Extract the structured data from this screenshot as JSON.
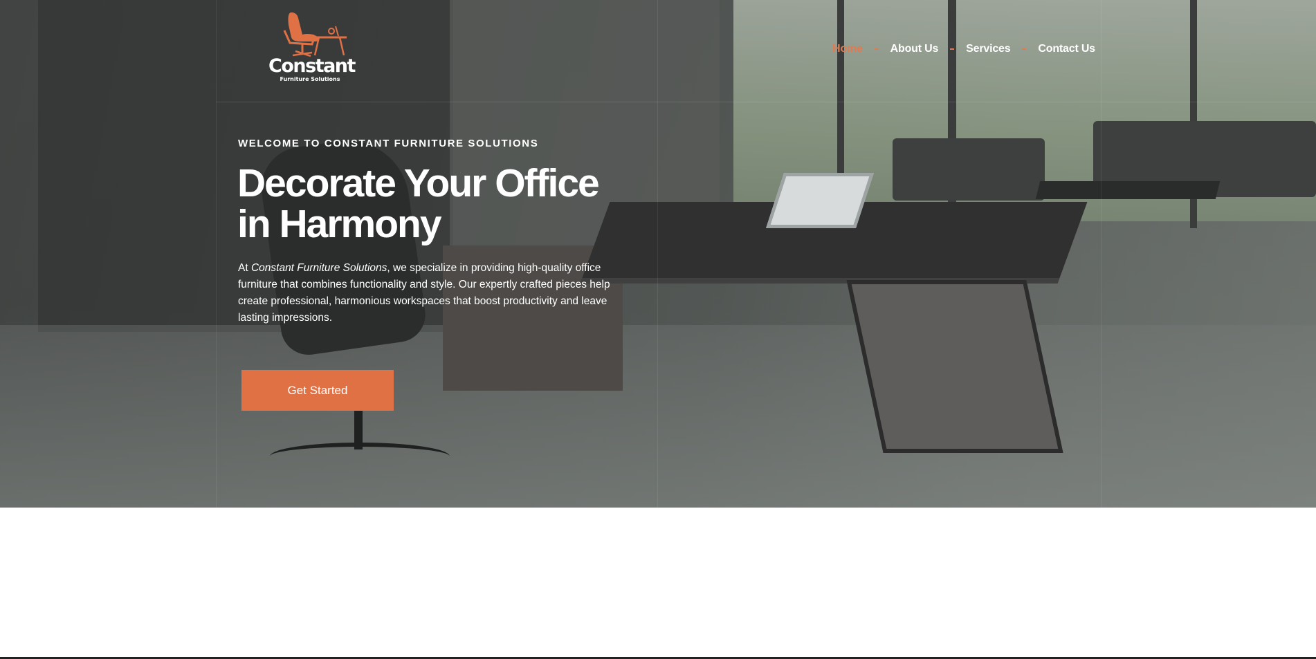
{
  "brand": {
    "name": "Constant",
    "tagline": "Furniture Solutions",
    "accent_color": "#e07145"
  },
  "nav": {
    "items": [
      {
        "label": "Home",
        "active": true
      },
      {
        "label": "About Us",
        "active": false
      },
      {
        "label": "Services",
        "active": false
      },
      {
        "label": "Contact Us",
        "active": false
      }
    ]
  },
  "hero": {
    "eyebrow": "WELCOME TO CONSTANT FURNITURE SOLUTIONS",
    "headline_line1": "Decorate Your Office",
    "headline_line2": "in Harmony",
    "desc_prefix": "At ",
    "desc_company": "Constant Furniture Solutions",
    "desc_rest": ", we specialize in providing high-quality office furniture that combines functionality and style. Our expertly crafted pieces help create professional, harmonious workspaces that boost productivity and leave lasting impressions.",
    "cta_label": "Get Started",
    "background_image": "office-interior-photo"
  }
}
